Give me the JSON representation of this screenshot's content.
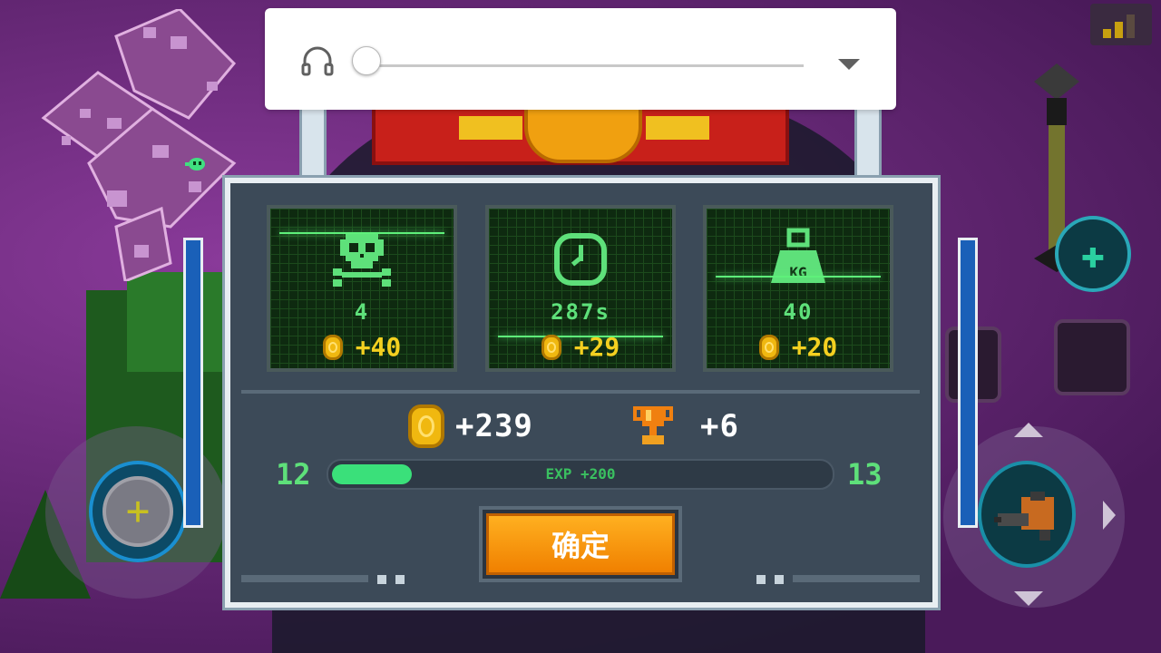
{
  "media_overlay": {
    "icon": "headphones-icon",
    "volume": 0,
    "dropdown_icon": "chevron-down-icon"
  },
  "hud": {
    "signal_icon": "signal-icon",
    "heal_icon": "heal-icon",
    "weapon_icon": "gun-icon",
    "joystick_icon": "plus-icon"
  },
  "results": {
    "stats": [
      {
        "icon": "skull-icon",
        "value": "4",
        "reward": "+40"
      },
      {
        "icon": "clock-icon",
        "value": "287s",
        "reward": "+29"
      },
      {
        "icon": "weight-icon",
        "icon_text": "KG",
        "value": "40",
        "reward": "+20"
      }
    ],
    "total_coins": "+239",
    "trophies": "+6",
    "level_current": "12",
    "level_next": "13",
    "exp_label": "EXP +200",
    "exp_progress": 0.16,
    "confirm_label": "确定"
  },
  "colors": {
    "stat_green": "#5ee07a",
    "coin_gold": "#f0b810",
    "confirm_orange": "#f09010",
    "panel": "#3c4a58"
  }
}
